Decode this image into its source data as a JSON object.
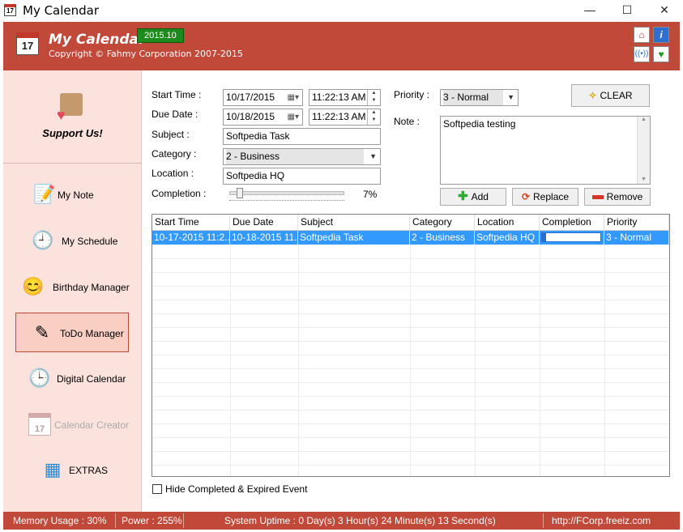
{
  "window": {
    "title": "My Calendar",
    "minimize": "—",
    "maximize": "☐",
    "close": "✕"
  },
  "header": {
    "app_name": "My Calendar",
    "version": "2015.10",
    "copyright": "Copyright © Fahmy Corporation 2007-2015",
    "logo_day": "17"
  },
  "sidebar": {
    "support_label": "Support Us!",
    "items": [
      {
        "label": "My Note",
        "icon": "notepad-icon",
        "glyph": "📝"
      },
      {
        "label": "My Schedule",
        "icon": "clock-icon",
        "glyph": "🕘"
      },
      {
        "label": "Birthday Manager",
        "icon": "smiley-icon",
        "glyph": "😊"
      },
      {
        "label": "ToDo Manager",
        "icon": "todo-icon",
        "glyph": "✎"
      },
      {
        "label": "Digital Calendar",
        "icon": "calendar-clock-icon",
        "glyph": "🕒"
      },
      {
        "label": "Calendar Creator",
        "icon": "calendar-icon",
        "glyph": "17"
      },
      {
        "label": "EXTRAS",
        "icon": "cubes-icon",
        "glyph": "▦"
      }
    ]
  },
  "form": {
    "start_time_label": "Start Time :",
    "start_date": "10/17/2015",
    "start_time": "11:22:13 AM",
    "due_date_label": "Due Date :",
    "due_date": "10/18/2015",
    "due_time": "11:22:13 AM",
    "subject_label": "Subject :",
    "subject": "Softpedia Task",
    "category_label": "Category :",
    "category": "2 - Business",
    "location_label": "Location :",
    "location": "Softpedia HQ",
    "completion_label": "Completion :",
    "completion_text": "7%",
    "completion_value": 7,
    "priority_label": "Priority :",
    "priority": "3 - Normal",
    "note_label": "Note :",
    "note": "Softpedia testing",
    "clear_label": "CLEAR",
    "add_label": "Add",
    "replace_label": "Replace",
    "remove_label": "Remove"
  },
  "grid": {
    "columns": [
      "Start Time",
      "Due Date",
      "Subject",
      "Category",
      "Location",
      "Completion",
      "Priority"
    ],
    "rows": [
      {
        "start": "10-17-2015 11:2...",
        "due": "10-18-2015 11...",
        "subject": "Softpedia Task",
        "category": "2 - Business",
        "location": "Softpedia HQ",
        "completion": 7,
        "priority": "3 - Normal"
      }
    ]
  },
  "hide_completed_label": "Hide Completed & Expired Event",
  "status": {
    "memory": "Memory Usage : 30%",
    "power": "Power : 255%",
    "uptime": "System Uptime : 0 Day(s) 3 Hour(s) 24 Minute(s) 13 Second(s)",
    "url": "http://FCorp.freeiz.com"
  },
  "colors": {
    "brand": "#c0493a",
    "sidebar_bg": "#fbe2dc",
    "selection": "#3399ff",
    "version_badge": "#1e8a1e"
  }
}
